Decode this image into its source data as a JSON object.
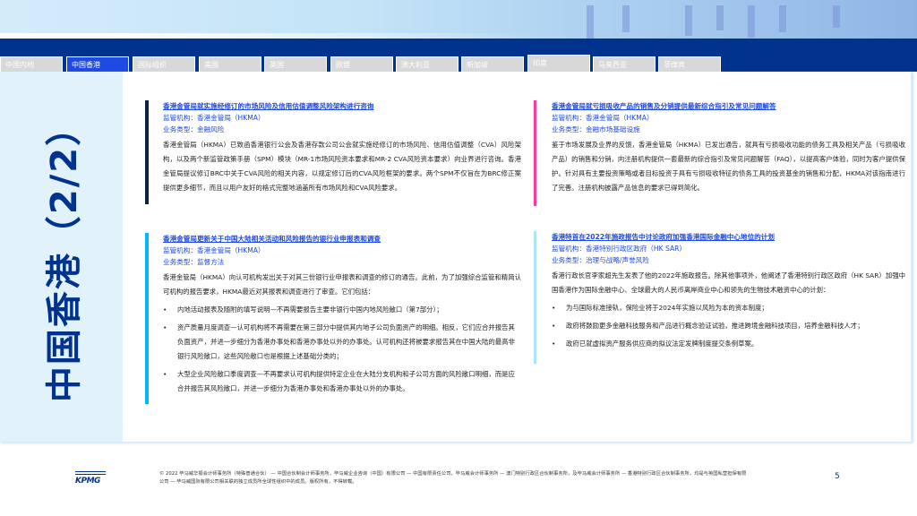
{
  "tabs": [
    {
      "label": "中国内地"
    },
    {
      "label": "中国香港",
      "active": true
    },
    {
      "label": "国际组织"
    },
    {
      "label": "美国"
    },
    {
      "label": "英国"
    },
    {
      "label": "欧盟"
    },
    {
      "label": "澳大利亚"
    },
    {
      "label": "新加坡"
    },
    {
      "label": "印度"
    },
    {
      "label": "马来西亚"
    },
    {
      "label": "菲律宾"
    }
  ],
  "page_title": "中国香港（2/2）",
  "colors": {
    "navy": "#00338d",
    "tab_active": "#1e49e2",
    "accent1": "#0c2340",
    "accent2": "#00b8f5",
    "accent3": "#ff3a9e",
    "accent4": "#a9e6fb"
  },
  "cards": [
    {
      "title": "香港金管局就实施经修订的市场风险及信用估值调整风险架构进行咨询",
      "regulator": "监管机构：香港金管局（HKMA）",
      "type": "业务类型：金融风险",
      "body": "香港金管局（HKMA）已致函香港银行公会及香港存款公司公会就实施经修订的市场风险、信用估值调整（CVA）风险架构，以及两个新监管政策手册（SPM）模块（MR-1市场风险资本要求和MR-2 CVA风险资本要求）向业界进行咨询。香港金管局提议修订BRC中关于CVA风险的相关内容，以规定修订后的CVA风险框架的要求。两个SPM不仅旨在为BRC修正案提供更多细节，而且以用户友好的格式完整地涵盖所有市场风险和CVA风险要求。",
      "bullets": []
    },
    {
      "title": "香港金管局就亏损吸收产品的销售及分销提供最新综合指引及常见问题解答",
      "regulator": "监管机构：香港金管局（HKMA）",
      "type": "业务类型：金融市场基础设施",
      "body": "鉴于市场发展及业界的反馈，香港金管局（HKMA）已发出通告，就具有亏损吸收功能的债务工具及相关产品（亏损吸收产品）的销售和分销，向注册机构提供一套最新的综合指引及常见问题解答（FAQ），以提高客户体验，同时为客户提供保护。针对具有主要投资策略或者目标投资于具有亏损吸收特征的债务工具的投资基金的销售和分配，HKMA对该指南进行了完善。注册机构披露产品信息的要求已得到简化。",
      "bullets": []
    },
    {
      "title": "香港金管局更新关于中国大陆相关活动和风险报告的银行业申报表和调查",
      "regulator": "监管机构：香港金管局（HKMA）",
      "type": "业务类型：监督方法",
      "body": "香港金管局（HKMA）向认可机构发出关于对其三份银行业申报表和调查的修订的通告。此前，为了加强综合监管和精简认可机构的报告要求，HKMA最近对其报表和调查进行了审查。它们包括：",
      "bullets": [
        "内地活动报表及随附的填写说明—不再需要报告主要非银行中国内地风险敞口（第7部分）；",
        "资产质量月度调查—认可机构将不再需要在第三部分中提供其内地子公司负面资产的明细。相反，它们应合并报告其负面资产，并进一步细分为香港办事处和香港办事处以外的办事处。认可机构还将被要求报告其在中国大陆的最高非银行风险敞口，这些风险敞口也是根据上述基础分类的；",
        "大型企业风险敞口季度调查—不再要求认可机构提供特定企业在大陆分支机构和子公司方面的风险敞口明细，而是应合并报告其风险敞口，并进一步细分为香港办事处和香港办事处以外的办事处。"
      ]
    },
    {
      "title": "香港特首在2022年施政报告中讨论政府加强香港国际金融中心地位的计划",
      "regulator": "监管机构：香港特别行政区政府（HK SAR）",
      "type": "业务类型：治理与战略/声誉风险",
      "body": "香港行政长官李家超先生发表了他的2022年施政报告。除其他事项外，他阐述了香港特别行政区政府（HK SAR）加强中国香港作为国际金融中心、全球最大的人民币离岸商业中心和领先的生物技术融资中心的计划：",
      "bullets": [
        "为与国际标准接轨，保险业将于2024年实施以风险为本的资本制度；",
        "政府将鼓励更多金融科技服务和产品进行概念验证试验，推进跨境金融科技项目，培养金融科技人才；",
        "政府已就虚拟资产服务供应商的拟议法定发牌制度提交条例草案。"
      ]
    }
  ],
  "footer": {
    "logo": "KPMG",
    "copyright": "© 2022 毕马威华振会计师事务所（特殊普通合伙） — 中国合伙制会计师事务所，毕马威企业咨询（中国）有限公司 — 中国有限责任公司，毕马威会计师事务所 — 澳门特别行政区合伙制事务所，及毕马威会计师事务所 — 香港特别行政区合伙制事务所，均是与英国私营担保有限公司 — 毕马威国际有限公司相关联的独立成员所全球性组织中的成员。版权所有，不得转载。",
    "page": "5"
  }
}
